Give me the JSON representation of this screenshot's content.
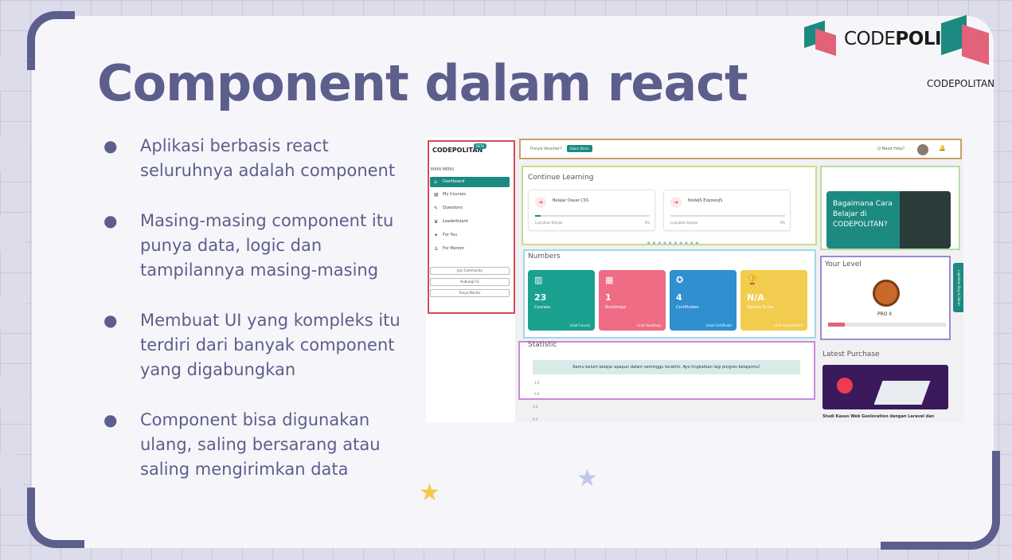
{
  "slide": {
    "title": "Component dalam react",
    "bullets": [
      "Aplikasi berbasis react seluruhnya adalah component",
      "Masing-masing component itu punya data, logic dan tampilannya masing-masing",
      "Membuat UI yang kompleks itu terdiri dari banyak component yang digabungkan",
      "Component bisa digunakan ulang, saling bersarang atau saling mengirimkan data"
    ],
    "bullet_glyph": "●",
    "brand": {
      "prefix": "CODE",
      "bold": "POLITAN"
    },
    "brand_sub": "CODEPOLITAN",
    "colors": {
      "title": "#5c5e8c",
      "teal": "#1c8a80",
      "pink": "#e2627a"
    }
  },
  "dashboard": {
    "sidebar": {
      "logo": "CODEPOLITAN",
      "badge": "BETA",
      "menu_label": "MAIN MENU",
      "items": [
        {
          "label": "Dashboard",
          "icon": "⌂"
        },
        {
          "label": "My Courses",
          "icon": "▤"
        },
        {
          "label": "Questions",
          "icon": "✎"
        },
        {
          "label": "Leaderboard",
          "icon": "♛"
        },
        {
          "label": "For You",
          "icon": "✦"
        },
        {
          "label": "For Mentor",
          "icon": "♙"
        }
      ],
      "buttons": [
        "Join Community",
        "Hubungi CS",
        "Tanya Mentor"
      ]
    },
    "topbar": {
      "voucher": "Punya Voucher?",
      "chip": "Klaim Disini",
      "help": "Q Need Help?",
      "bell": "🔔"
    },
    "continue_learning": {
      "title": "Continue Learning",
      "cards": [
        {
          "name": "Belajar Dasar CSS",
          "sub": "Lanjutkan Belajar",
          "pct": "5%",
          "progress": 0.05
        },
        {
          "name": "NodeJS ExpressJS",
          "sub": "Lanjutkan belajar",
          "pct": "0%",
          "progress": 0.0
        }
      ]
    },
    "promo": {
      "text": "Bagaimana Cara Belajar di CODEPOLITAN?"
    },
    "numbers": {
      "title": "Numbers",
      "cards": [
        {
          "value": "23",
          "label": "Courses",
          "link": "Lihat Course",
          "color": "#1aa18f",
          "icon": "▥"
        },
        {
          "value": "1",
          "label": "Roadmaps",
          "link": "Lihat Roadmap",
          "color": "#ef6c84",
          "icon": "▦"
        },
        {
          "value": "4",
          "label": "Certificates",
          "link": "Lihat Certificate",
          "color": "#2f8fcf",
          "icon": "✪"
        },
        {
          "value": "N/A",
          "label": "Weekly Score",
          "link": "Lihat Leaderboard",
          "color": "#f1cc4f",
          "icon": "🏆"
        }
      ]
    },
    "level": {
      "title": "Your Level",
      "name": "PRO II",
      "progress": 0.14
    },
    "side_tab": "Laporkan Bug & Saran",
    "statistic": {
      "title": "Statistic",
      "banner": "Kamu belum belajar apapun dalam seminggu terakhir. Ayo tingkatkan lagi progres belajarmu!",
      "axis": [
        "1.0",
        "0.8",
        "0.6",
        "0.4"
      ]
    },
    "latest_purchase": {
      "title": "Latest Purchase",
      "caption": "Studi Kasus Web Geolocation dengan Laravel dan"
    }
  }
}
